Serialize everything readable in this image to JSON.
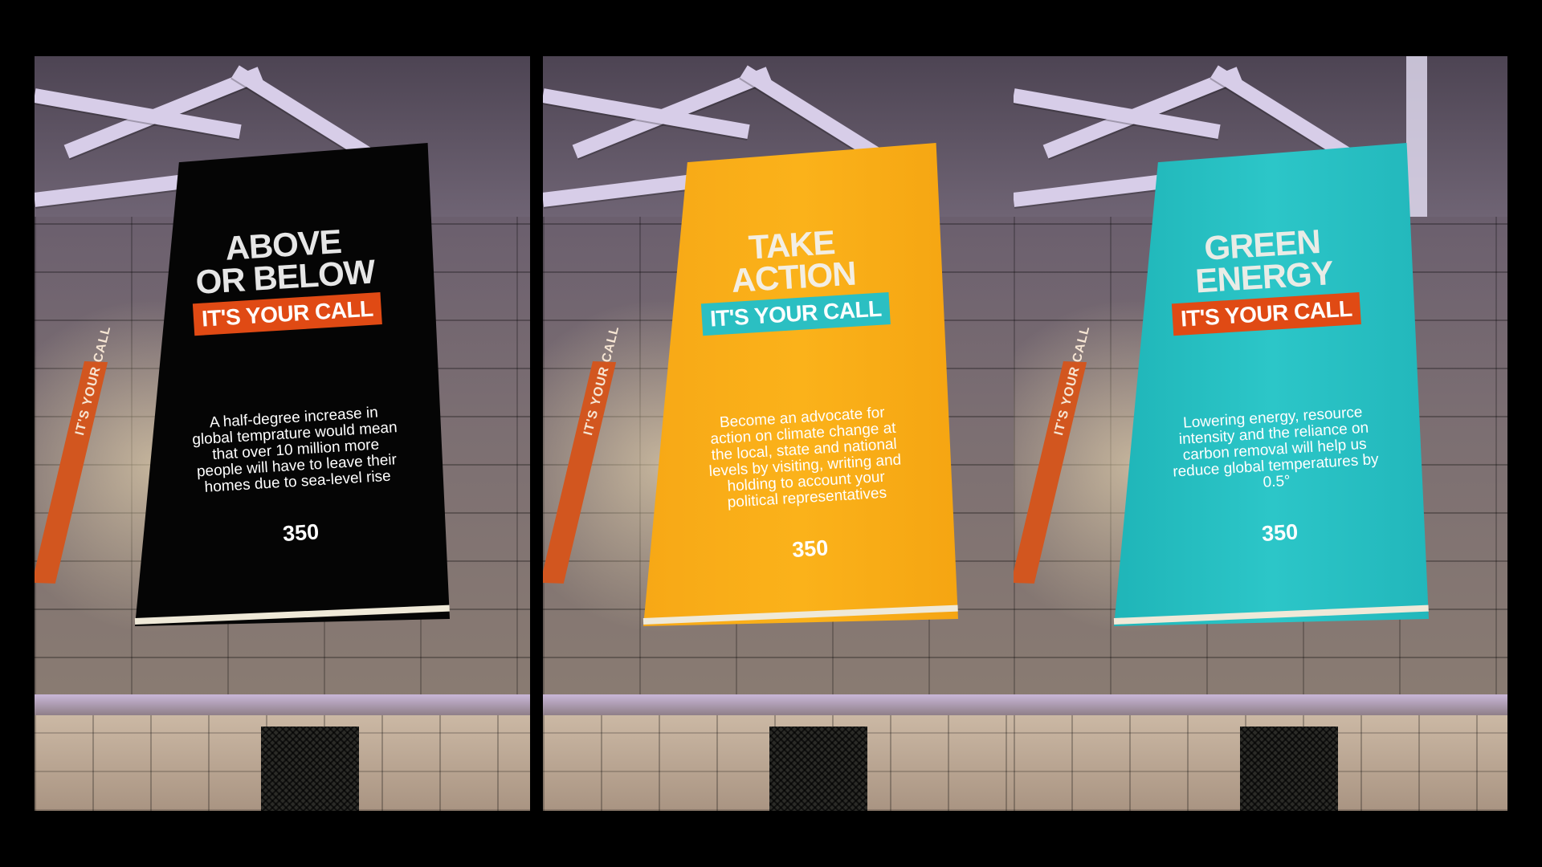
{
  "panels": [
    {
      "id": "black",
      "banner_color": "#050505",
      "headline": "ABOVE\nOR BELOW",
      "tag": "IT'S YOUR CALL",
      "tag_color": "#e04a14",
      "body": "A half-degree increase in global temprature would mean that over 10 million more people will have to leave their homes due to sea-level rise",
      "logo": "350",
      "side_banner": "IT'S YOUR CALL"
    },
    {
      "id": "yellow",
      "banner_color": "#fbb21a",
      "headline": "TAKE\nACTION",
      "tag": "IT'S YOUR CALL",
      "tag_color": "#2bbfc2",
      "body": "Become an advocate for action on climate change at the local, state and national levels by visiting, writing and holding to account your political representatives",
      "logo": "350",
      "side_banner": "IT'S YOUR CALL"
    },
    {
      "id": "teal",
      "banner_color": "#2cc6c8",
      "headline": "GREEN\nENERGY",
      "tag": "IT'S YOUR CALL",
      "tag_color": "#e04a14",
      "body": "Lowering energy, resource intensity and the reliance on carbon removal will help us reduce global temperatures by 0.5°",
      "logo": "350",
      "side_banner": "IT'S YOUR CALL"
    }
  ]
}
